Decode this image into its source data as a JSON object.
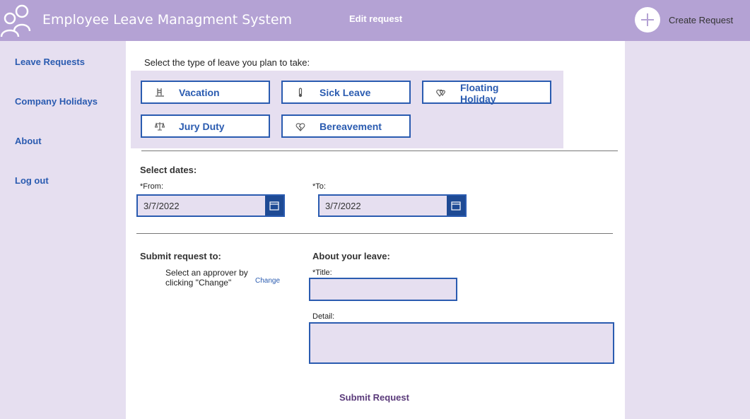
{
  "header": {
    "app_title": "Employee Leave Managment System",
    "page_title": "Edit request",
    "create_label": "Create Request",
    "logo_icon": "people-icon",
    "accent": "#b4a2d4"
  },
  "sidebar": {
    "items": [
      {
        "label": "Leave Requests"
      },
      {
        "label": "Company Holidays"
      },
      {
        "label": "About"
      },
      {
        "label": "Log out"
      }
    ]
  },
  "leave_type": {
    "prompt": "Select the type of leave you plan to take:",
    "options": [
      {
        "label": "Vacation",
        "icon": "pool-ladder-icon"
      },
      {
        "label": "Sick Leave",
        "icon": "thermometer-icon"
      },
      {
        "label": "Floating Holiday",
        "icon": "hearts-icon"
      },
      {
        "label": "Jury Duty",
        "icon": "scales-icon"
      },
      {
        "label": "Bereavement",
        "icon": "broken-heart-icon"
      }
    ]
  },
  "dates": {
    "heading": "Select dates:",
    "from_label": "*From:",
    "from_value": "3/7/2022",
    "to_label": "*To:",
    "to_value": "3/7/2022"
  },
  "approver": {
    "heading": "Submit request to:",
    "hint": "Select an approver by clicking \"Change\"",
    "change_label": "Change"
  },
  "about": {
    "heading": "About your leave:",
    "title_label": "*Title:",
    "title_value": "",
    "detail_label": "Detail:",
    "detail_value": ""
  },
  "submit_label": "Submit Request"
}
